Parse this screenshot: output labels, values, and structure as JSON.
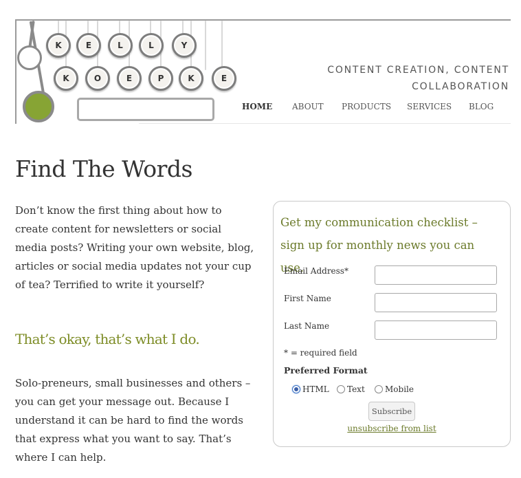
{
  "header": {
    "logo_keys_top": [
      "K",
      "E",
      "L",
      "L",
      "Y"
    ],
    "logo_keys_bottom": [
      "K",
      "O",
      "E",
      "P",
      "K",
      "E"
    ],
    "tagline_line1": "CONTENT CREATION, CONTENT",
    "tagline_line2": "COLLABORATION",
    "nav": {
      "home": "HOME",
      "about": "ABOUT",
      "products": "PRODUCTS",
      "services": "SERVICES",
      "blog": "BLOG"
    },
    "accent_green": "#87a434"
  },
  "main": {
    "title": "Find The Words",
    "intro": "Don’t know the first thing about how to create content for newsletters or social media posts? Writing your own website, blog, articles or social media updates not your cup of tea? Terrified to write it yourself?",
    "subheading": "That’s okay, that’s what I do.",
    "body": "Solo-preneurs, small businesses and others  – you can get your message out. Because I understand it can be hard to find the words that express what you want to say. That’s where I can help."
  },
  "signup": {
    "heading": "Get my communication checklist – sign up for monthly news you can use.",
    "email_label": "Email Address*",
    "email_value": "",
    "first_name_label": "First Name",
    "first_name_value": "",
    "last_name_label": "Last Name",
    "last_name_value": "",
    "required_note": "* = required field",
    "format_label": "Preferred Format",
    "format_options": [
      "HTML",
      "Text",
      "Mobile"
    ],
    "format_selected": "HTML",
    "subscribe_label": "Subscribe",
    "unsubscribe_label": "unsubscribe from list"
  }
}
